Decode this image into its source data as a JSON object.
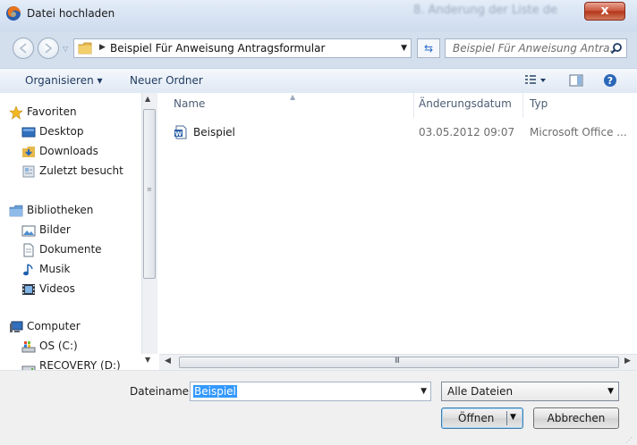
{
  "window": {
    "title": "Datei hochladen",
    "background_title": "8. Änderung der Liste de",
    "close_label": "x"
  },
  "address_bar": {
    "path": "Beispiel Für Anweisung Antragsformular",
    "search_placeholder": "Beispiel Für Anweisung Antra..."
  },
  "command_bar": {
    "organize_label": "Organisieren ▾",
    "new_folder_label": "Neuer Ordner"
  },
  "nav_tree": {
    "groups": [
      {
        "label": "Favoriten",
        "items": [
          "Desktop",
          "Downloads",
          "Zuletzt besucht"
        ]
      },
      {
        "label": "Bibliotheken",
        "items": [
          "Bilder",
          "Dokumente",
          "Musik",
          "Videos"
        ]
      },
      {
        "label": "Computer",
        "items": [
          "OS (C:)",
          "RECOVERY (D:)"
        ]
      }
    ]
  },
  "file_list": {
    "columns": [
      "Name",
      "Änderungsdatum",
      "Typ"
    ],
    "rows": [
      {
        "name": "Beispiel",
        "date": "03.05.2012 09:07",
        "type": "Microsoft Office ..."
      }
    ]
  },
  "scrollbar": {
    "grip_label": "III"
  },
  "bottom": {
    "filename_label": "Dateiname:",
    "filename_value": "Beispiel",
    "filter_value": "Alle Dateien",
    "open_label": "Öffnen",
    "cancel_label": "Abbrechen"
  },
  "colors": {
    "accent": "#3399ff",
    "chrome": "#d4dfee",
    "close": "#c8523a"
  }
}
